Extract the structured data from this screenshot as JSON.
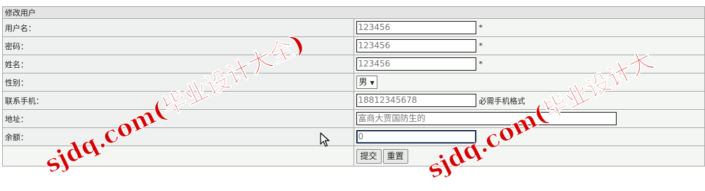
{
  "form": {
    "title": "修改用户",
    "rows": [
      {
        "label": "用户名：",
        "value": "123456",
        "note": "*"
      },
      {
        "label": "密码：",
        "value": "123456",
        "note": "*"
      },
      {
        "label": "姓名：",
        "value": "123456",
        "note": "*"
      },
      {
        "label": "性别：",
        "selected": "男"
      },
      {
        "label": "联系手机：",
        "value": "18812345678",
        "note": "必需手机格式"
      },
      {
        "label": "地址：",
        "value": "富商大贾国防生的"
      },
      {
        "label": "余额：",
        "value": "0"
      }
    ],
    "submit_label": "提交",
    "reset_label": "重置"
  },
  "watermarks": [
    "sjdq.com(毕业设计大全)",
    "sjdq.com(毕业设计大"
  ],
  "icons": {
    "dropdown": "triangle-down-icon",
    "cursor": "mouse-pointer-icon"
  },
  "colors": {
    "border": "#a8a8a8",
    "header_bg": "#e4e4e4",
    "watermark": "#d40000"
  }
}
